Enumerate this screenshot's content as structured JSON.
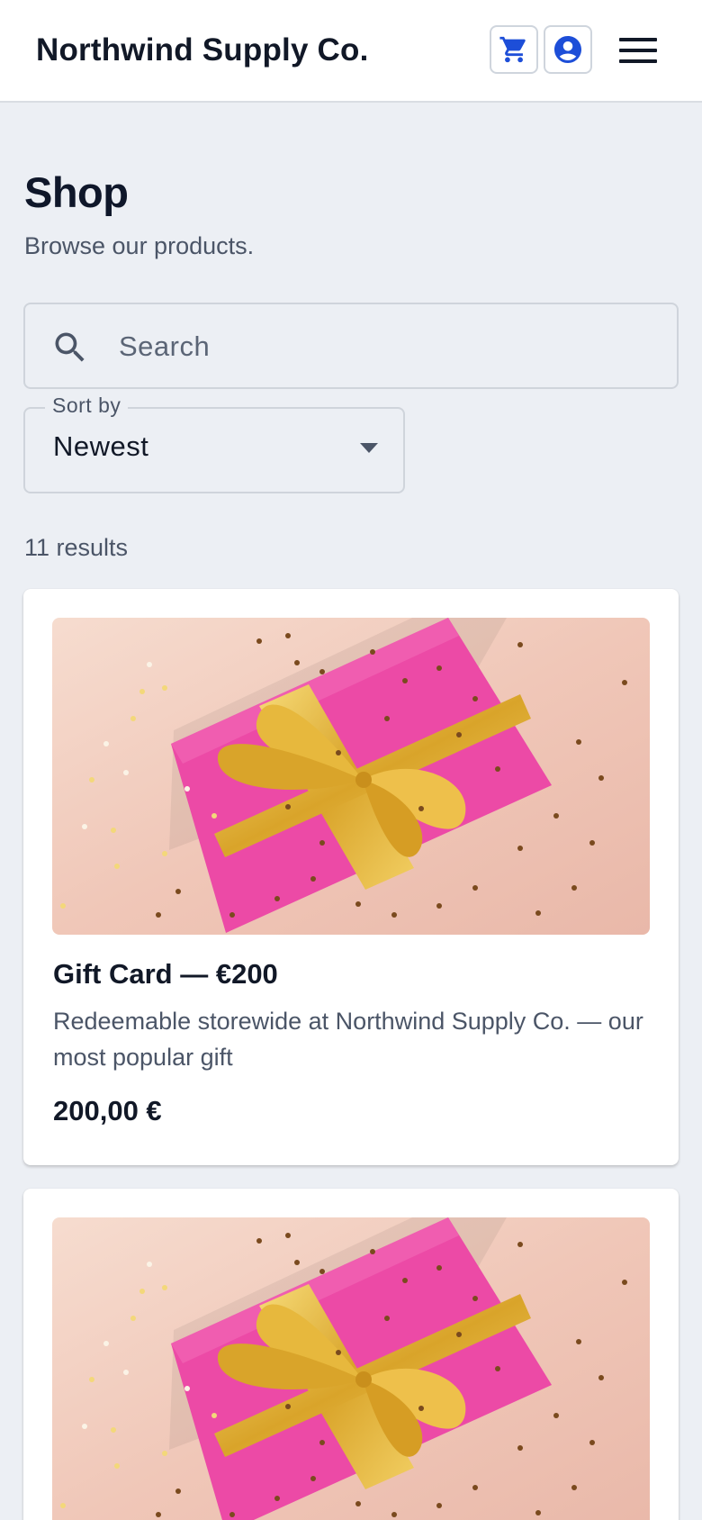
{
  "header": {
    "brand": "Northwind Supply Co.",
    "cart_icon": "shopping-cart-icon",
    "account_icon": "account-circle-icon",
    "menu_icon": "hamburger-menu-icon",
    "accent_color": "#1d4ed8"
  },
  "page": {
    "title": "Shop",
    "subtitle": "Browse our products."
  },
  "search": {
    "placeholder": "Search",
    "value": "",
    "icon": "search-icon"
  },
  "sort": {
    "label": "Sort by",
    "selected": "Newest",
    "icon": "caret-down-icon"
  },
  "results": {
    "count_text": "11 results"
  },
  "products": [
    {
      "title": "Gift Card — €200",
      "description": "Redeemable storewide at Northwind Supply Co. — our most popular gift",
      "price": "200,00 €",
      "image": "gift-box-photo"
    },
    {
      "image": "gift-box-photo"
    }
  ]
}
